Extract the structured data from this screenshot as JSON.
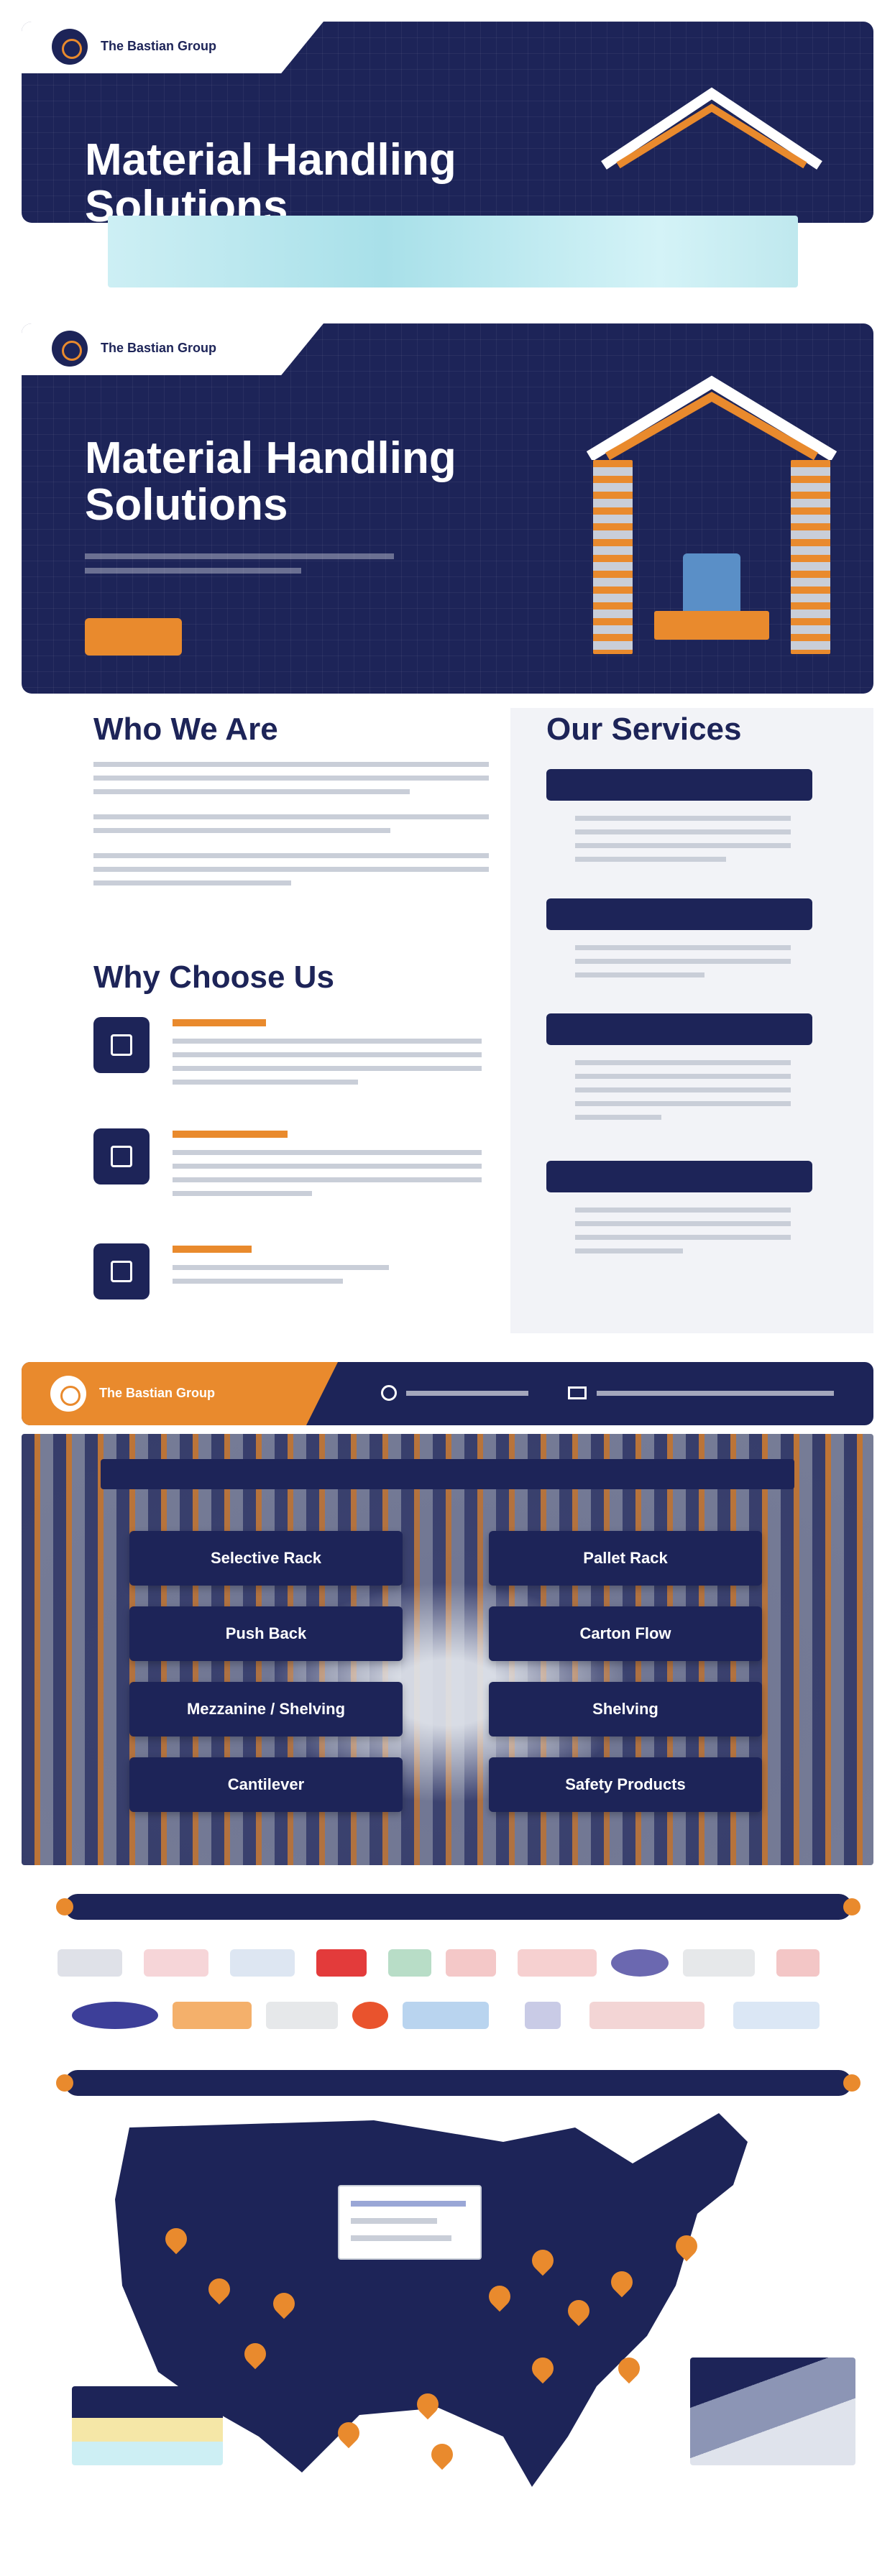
{
  "brand": {
    "name": "The Bastian Group",
    "navy": "#1d2458",
    "orange": "#e98a2d"
  },
  "hero": {
    "title_line1": "Material Handling",
    "title_line2": "Solutions"
  },
  "who_we_are": {
    "heading": "Who We Are"
  },
  "why_choose_us": {
    "heading": "Why Choose Us"
  },
  "services": {
    "heading": "Our Services"
  },
  "equipment": {
    "items": [
      "Selective Rack",
      "Pallet Rack",
      "Push Back",
      "Carton Flow",
      "Mezzanine / Shelving",
      "Shelving",
      "Cantilever",
      "Safety Products"
    ]
  },
  "icons": {
    "logo": "company-logo-icon",
    "phone": "phone-icon",
    "email": "email-icon"
  }
}
